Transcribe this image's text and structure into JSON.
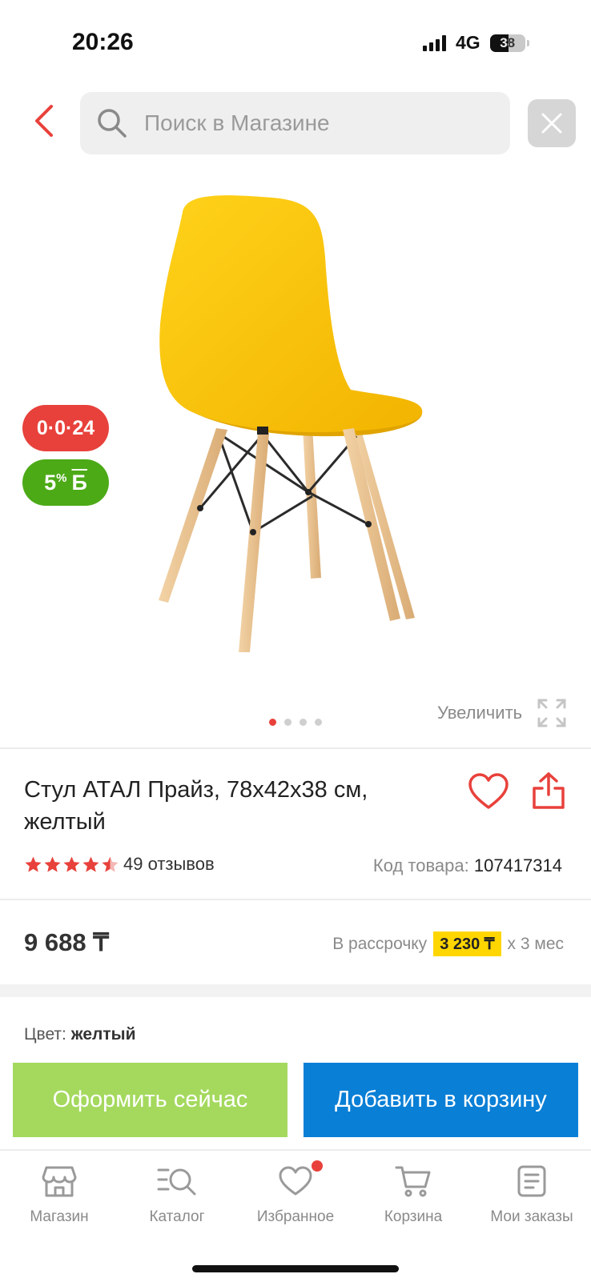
{
  "status_bar": {
    "time": "20:26",
    "network": "4G",
    "battery": "38"
  },
  "header": {
    "search_placeholder": "Поиск в Магазине"
  },
  "gallery": {
    "badge_installment": "0·0·24",
    "badge_bonus_percent": "5",
    "badge_bonus_sign": "%",
    "badge_bonus_currency": "Б",
    "zoom_label": "Увеличить",
    "image_count": 4,
    "active_image": 1
  },
  "product": {
    "title_line1": "Стул АТАЛ Прайз, 78x42x38 см,",
    "title_line2": "желтый",
    "rating": 4.5,
    "reviews_label": "49 отзывов",
    "code_label": "Код товара:",
    "code_value": "107417314",
    "price": "9 688 ₸",
    "installment_prefix": "В рассрочку",
    "installment_amount": "3 230 ₸",
    "installment_suffix": "x 3 мес",
    "color_label": "Цвет:",
    "color_value": "желтый"
  },
  "actions": {
    "buy_now": "Оформить сейчас",
    "add_to_cart": "Добавить в корзину"
  },
  "tabbar": {
    "items": [
      {
        "label": "Магазин",
        "icon": "shop-icon"
      },
      {
        "label": "Каталог",
        "icon": "catalog-search-icon"
      },
      {
        "label": "Избранное",
        "icon": "heart-icon"
      },
      {
        "label": "Корзина",
        "icon": "cart-icon"
      },
      {
        "label": "Мои заказы",
        "icon": "orders-icon"
      }
    ]
  },
  "colors": {
    "accent_red": "#e8413b",
    "bonus_green": "#4caa17",
    "buy_green": "#a4d95e",
    "cart_blue": "#0a7fd6",
    "installment_yellow": "#ffd600"
  }
}
